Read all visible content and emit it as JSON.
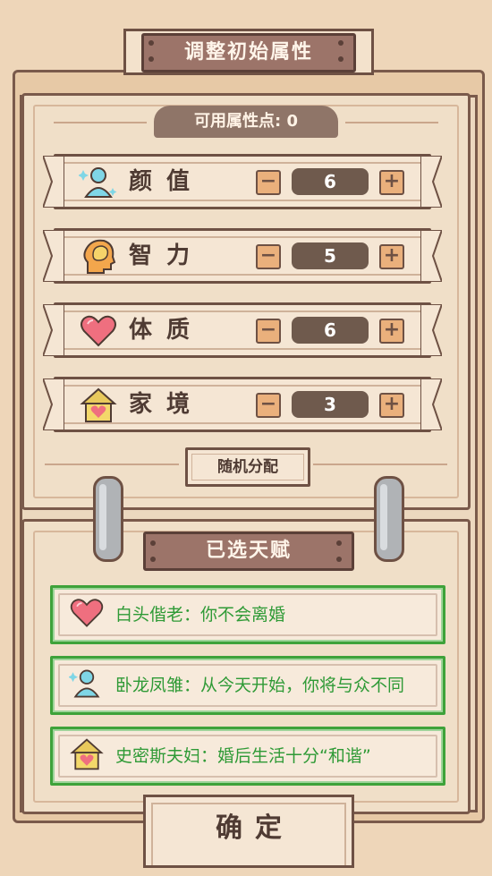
{
  "title": "调整初始属性",
  "available_points": "可用属性点: 0",
  "attributes": [
    {
      "label": "颜值",
      "value": "6",
      "icon": "person-icon"
    },
    {
      "label": "智力",
      "value": "5",
      "icon": "head-brain-icon"
    },
    {
      "label": "体质",
      "value": "6",
      "icon": "heart-icon"
    },
    {
      "label": "家境",
      "value": "3",
      "icon": "house-icon"
    }
  ],
  "controls": {
    "minus": "−",
    "plus": "+"
  },
  "random_button": "随机分配",
  "talents_title": "已选天赋",
  "talents": [
    {
      "text": "白头偕老：你不会离婚",
      "icon": "heart-icon"
    },
    {
      "text": "卧龙凤雏：从今天开始，你将与众不同",
      "icon": "person-icon"
    },
    {
      "text": "史密斯夫妇：婚后生活十分“和谐”",
      "icon": "house-icon"
    }
  ],
  "confirm_button": "确定",
  "colors": {
    "background": "#eed6b9",
    "frame": "#7a5a4b",
    "plate": "#9c7469",
    "value_box": "#6f5a4d",
    "talent_green": "#3ea23a",
    "button_orange": "#eab07c"
  }
}
